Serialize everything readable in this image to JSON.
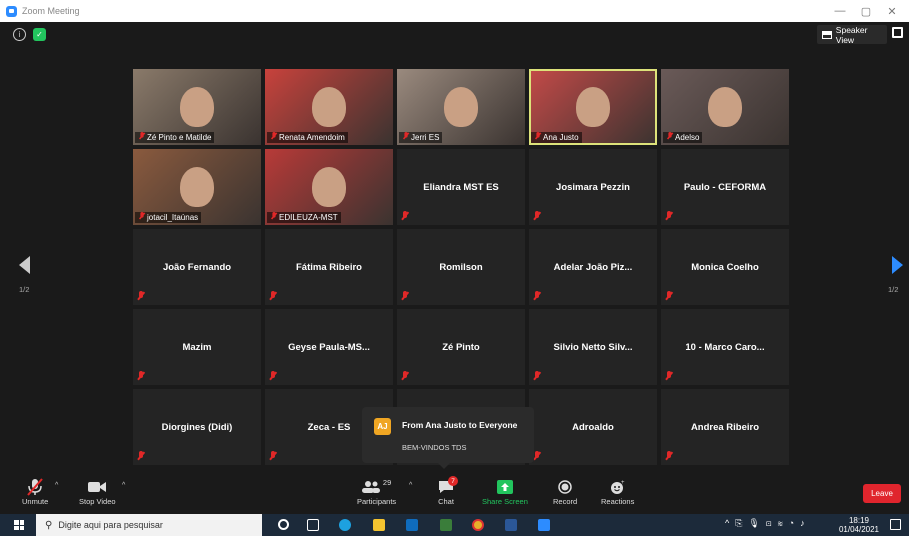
{
  "window": {
    "title": "Zoom Meeting"
  },
  "topbar": {
    "speaker_view_label": "Speaker View"
  },
  "navigation": {
    "left_page": "1/2",
    "right_page": "1/2"
  },
  "participants": [
    {
      "name": "Zé Pinto e Matilde",
      "video": true,
      "bg": "#8a7a6a"
    },
    {
      "name": "Renata Amendoim",
      "video": true,
      "bg": "#c8423c"
    },
    {
      "name": "Jerri ES",
      "video": true,
      "bg": "#9a8a7e"
    },
    {
      "name": "Ana Justo",
      "video": true,
      "bg": "#c44a48",
      "active": true
    },
    {
      "name": "Adelso",
      "video": true,
      "bg": "#6a5a58"
    },
    {
      "name": "jotacil_Itaúnas",
      "video": true,
      "bg": "#8a5a3e"
    },
    {
      "name": "EDILEUZA-MST",
      "video": true,
      "bg": "#b83a38"
    },
    {
      "name": "Eliandra MST ES",
      "video": false
    },
    {
      "name": "Josimara Pezzin",
      "video": false
    },
    {
      "name": "Paulo - CEFORMA",
      "video": false
    },
    {
      "name": "João Fernando",
      "video": false
    },
    {
      "name": "Fátima Ribeiro",
      "video": false
    },
    {
      "name": "Romilson",
      "video": false
    },
    {
      "name": "Adelar João Piz...",
      "video": false
    },
    {
      "name": "Monica Coelho",
      "video": false
    },
    {
      "name": "Mazim",
      "video": false
    },
    {
      "name": "Geyse Paula-MS...",
      "video": false
    },
    {
      "name": "Zé Pinto",
      "video": false
    },
    {
      "name": "Silvio Netto Silv...",
      "video": false
    },
    {
      "name": "10 - Marco Caro...",
      "video": false
    },
    {
      "name": "Diorgines (Didi)",
      "video": false
    },
    {
      "name": "Zeca - ES",
      "video": false
    },
    {
      "name": "",
      "video": false
    },
    {
      "name": "Adroaldo",
      "video": false
    },
    {
      "name": "Andrea Ribeiro",
      "video": false
    }
  ],
  "chat_popup": {
    "initials": "AJ",
    "from": "From Ana Justo to Everyone",
    "message": "BEM-VINDOS TDS"
  },
  "toolbar": {
    "unmute": "Unmute",
    "stop_video": "Stop Video",
    "participants": "Participants",
    "participants_count": "29",
    "chat": "Chat",
    "chat_badge": "7",
    "share_screen": "Share Screen",
    "record": "Record",
    "reactions": "Reactions",
    "leave": "Leave"
  },
  "taskbar": {
    "search_placeholder": "Digite aqui para pesquisar",
    "time": "18:19",
    "date": "01/04/2021"
  },
  "colors": {
    "accent": "#2d8cff",
    "leave": "#e0252d",
    "share": "#22c55e",
    "active_border": "#dde27a"
  }
}
